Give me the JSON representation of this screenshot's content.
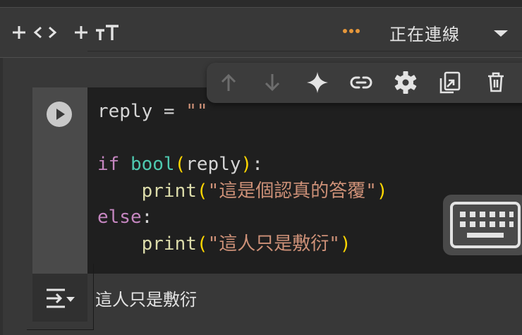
{
  "toolbar": {
    "add_code_icon": "plus-code-icon",
    "add_text_icon": "plus-text-icon",
    "connection_status": "正在連線",
    "connection_dots_color": "#e6973b"
  },
  "cell_toolbar": {
    "icons": [
      "arrow-up-icon",
      "arrow-down-icon",
      "sparkle-icon",
      "link-icon",
      "gear-icon",
      "mirror-cell-icon",
      "trash-icon"
    ]
  },
  "code": {
    "line1_var": "reply",
    "line1_op": " = ",
    "line1_val": "\"\"",
    "line3_kw": "if",
    "line3_fn": "bool",
    "line3_arg": "reply",
    "line3_tail": ":",
    "line4_fn": "print",
    "line4_str": "\"這是個認真的答覆\"",
    "line5_kw": "else",
    "line5_tail": ":",
    "line6_fn": "print",
    "line6_str": "\"這人只是敷衍\""
  },
  "output": {
    "text": "這人只是敷衍"
  },
  "colors": {
    "keyword": "#c586c0",
    "builtin": "#4ec9b0",
    "function": "#dcdcaa",
    "string": "#ce9178",
    "bracket": "#ffd700"
  }
}
